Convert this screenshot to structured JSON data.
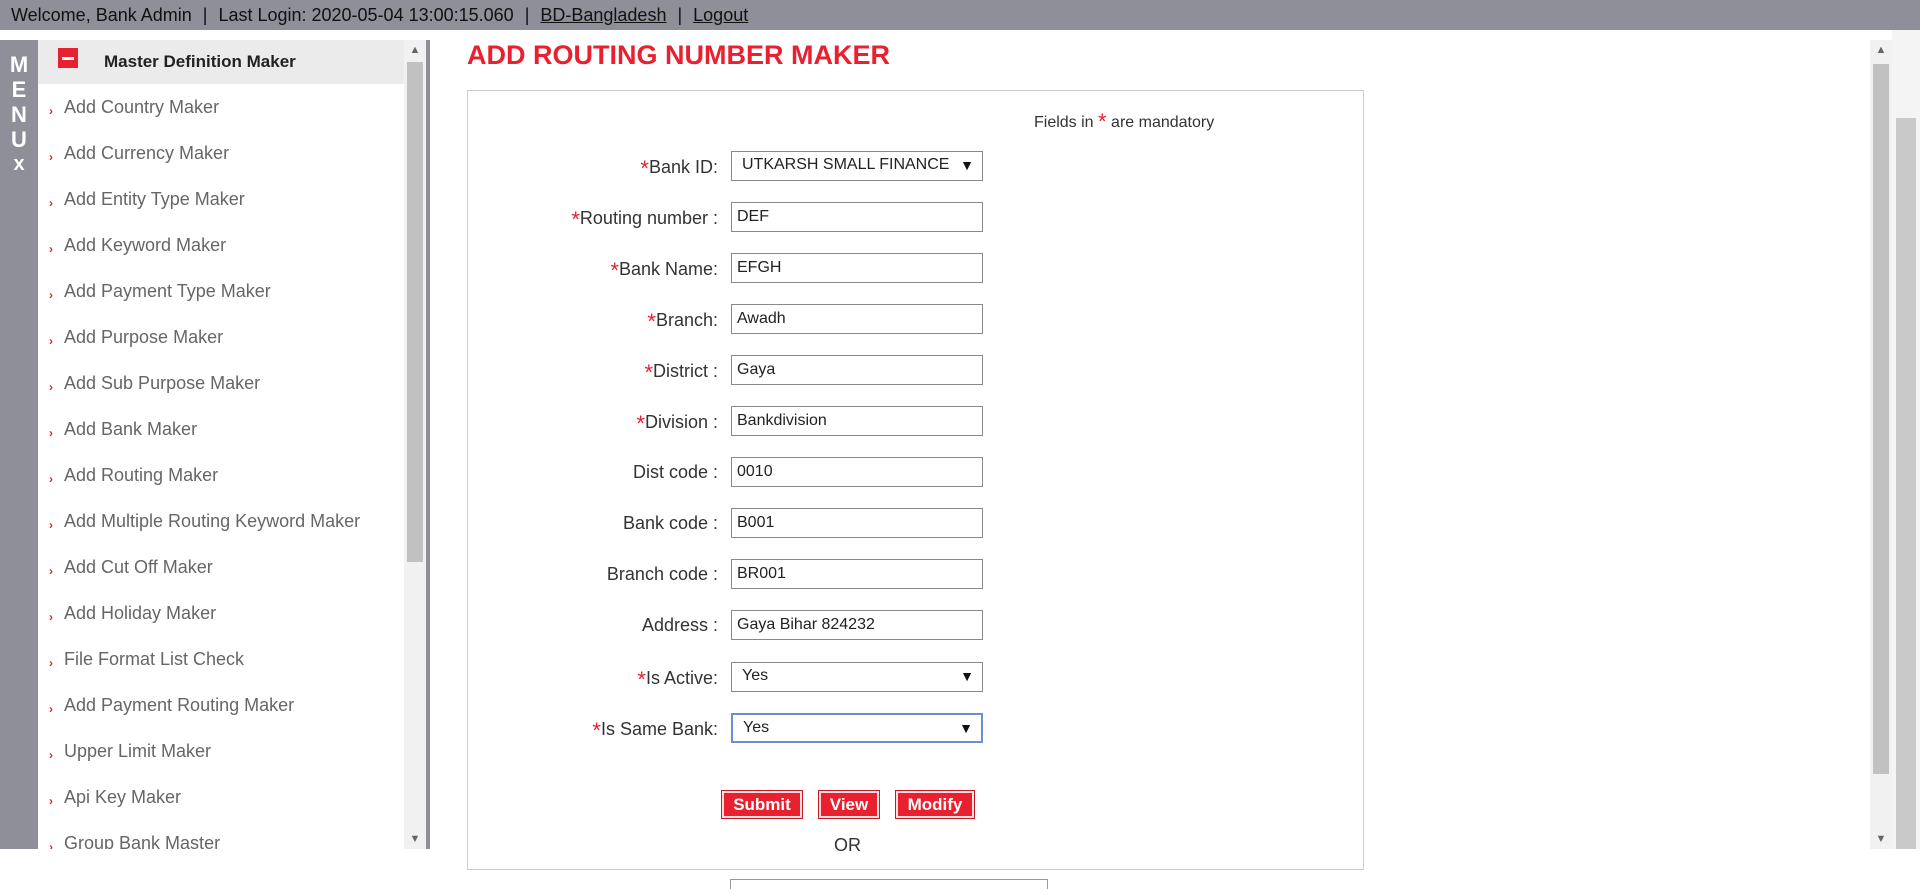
{
  "topbar": {
    "welcome": "Welcome, Bank Admin",
    "last_login": "Last Login: 2020-05-04 13:00:15.060",
    "region_link": "BD-Bangladesh",
    "logout_link": "Logout",
    "separator": "|"
  },
  "menu_strip": {
    "letters": [
      "M",
      "E",
      "N",
      "U"
    ],
    "close": "x"
  },
  "sidebar": {
    "section_title": "Master Definition Maker",
    "items": [
      {
        "label": "Add Country Maker"
      },
      {
        "label": "Add Currency Maker"
      },
      {
        "label": "Add Entity Type Maker"
      },
      {
        "label": "Add Keyword Maker"
      },
      {
        "label": "Add Payment Type Maker"
      },
      {
        "label": "Add Purpose Maker"
      },
      {
        "label": "Add Sub Purpose Maker"
      },
      {
        "label": "Add Bank Maker"
      },
      {
        "label": "Add Routing Maker"
      },
      {
        "label": "Add Multiple Routing Keyword Maker"
      },
      {
        "label": "Add Cut Off Maker"
      },
      {
        "label": "Add Holiday Maker"
      },
      {
        "label": "File Format List Check"
      },
      {
        "label": "Add Payment Routing Maker"
      },
      {
        "label": "Upper Limit Maker"
      },
      {
        "label": "Api Key Maker"
      },
      {
        "label": "Group Bank Master"
      }
    ]
  },
  "main": {
    "title": "ADD ROUTING NUMBER MAKER",
    "mandatory_note_prefix": "Fields in",
    "mandatory_note_star": "*",
    "mandatory_note_suffix": "are mandatory",
    "fields": {
      "bank_id": {
        "label": "Bank ID:",
        "value": "UTKARSH SMALL FINANCE"
      },
      "routing_number": {
        "label": "Routing number :",
        "value": "DEF"
      },
      "bank_name": {
        "label": "Bank Name:",
        "value": "EFGH"
      },
      "branch": {
        "label": "Branch:",
        "value": "Awadh"
      },
      "district": {
        "label": "District :",
        "value": "Gaya"
      },
      "division": {
        "label": "Division :",
        "value": "Bankdivision"
      },
      "dist_code": {
        "label": "Dist code :",
        "value": "0010"
      },
      "bank_code": {
        "label": "Bank code :",
        "value": "B001"
      },
      "branch_code": {
        "label": "Branch code :",
        "value": "BR001"
      },
      "address": {
        "label": "Address :",
        "value": "Gaya Bihar 824232"
      },
      "is_active": {
        "label": "Is Active:",
        "value": "Yes"
      },
      "is_same_bank": {
        "label": "Is Same Bank:",
        "value": "Yes"
      }
    },
    "buttons": {
      "submit": "Submit",
      "view": "View",
      "modify": "Modify"
    },
    "or_text": "OR"
  },
  "colors": {
    "accent": "#e8202f",
    "topbar": "#8f8f9a",
    "sidebar_header": "#ebebeb"
  }
}
